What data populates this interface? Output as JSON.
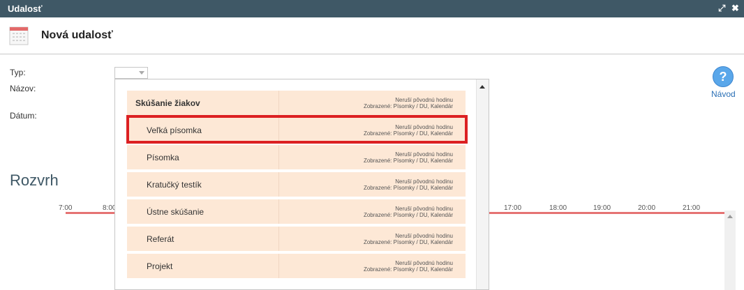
{
  "window": {
    "title": "Udalosť",
    "maximize_icon": "⤢",
    "close_icon": "✖"
  },
  "header": {
    "title": "Nová udalosť",
    "icon": "calendar-icon"
  },
  "form": {
    "type_label": "Typ:",
    "name_label": "Názov:",
    "date_label": "Dátum:"
  },
  "help": {
    "icon": "question-icon",
    "symbol": "?",
    "label": "Návod"
  },
  "schedule": {
    "title": "Rozvrh",
    "hours": [
      "7:00",
      "8:00",
      "17:00",
      "18:00",
      "19:00",
      "20:00",
      "21:00"
    ]
  },
  "dropdown": {
    "options": [
      {
        "name": "Skúšanie žiakov",
        "line1": "Neruší pôvodnú hodinu",
        "line2": "Zobrazené: Písomky / DU, Kalendár",
        "group": true
      },
      {
        "name": "Veľká písomka",
        "line1": "Neruší pôvodnú hodinu",
        "line2": "Zobrazené: Písomky / DU, Kalendár",
        "highlighted": true
      },
      {
        "name": "Písomka",
        "line1": "Neruší pôvodnú hodinu",
        "line2": "Zobrazené: Písomky / DU, Kalendár"
      },
      {
        "name": "Kratučký testík",
        "line1": "Neruší pôvodnú hodinu",
        "line2": "Zobrazené: Písomky / DU, Kalendár"
      },
      {
        "name": "Ústne skúšanie",
        "line1": "Neruší pôvodnú hodinu",
        "line2": "Zobrazené: Písomky / DU, Kalendár"
      },
      {
        "name": "Referát",
        "line1": "Neruší pôvodnú hodinu",
        "line2": "Zobrazené: Písomky / DU, Kalendár"
      },
      {
        "name": "Projekt",
        "line1": "Neruší pôvodnú hodinu",
        "line2": "Zobrazené: Písomky / DU, Kalendár"
      }
    ]
  },
  "colors": {
    "titlebar": "#3f5866",
    "option_bg": "#fde8d6",
    "highlight": "#dc2022",
    "timeline": "#e57373",
    "help": "#5aa7ea"
  }
}
